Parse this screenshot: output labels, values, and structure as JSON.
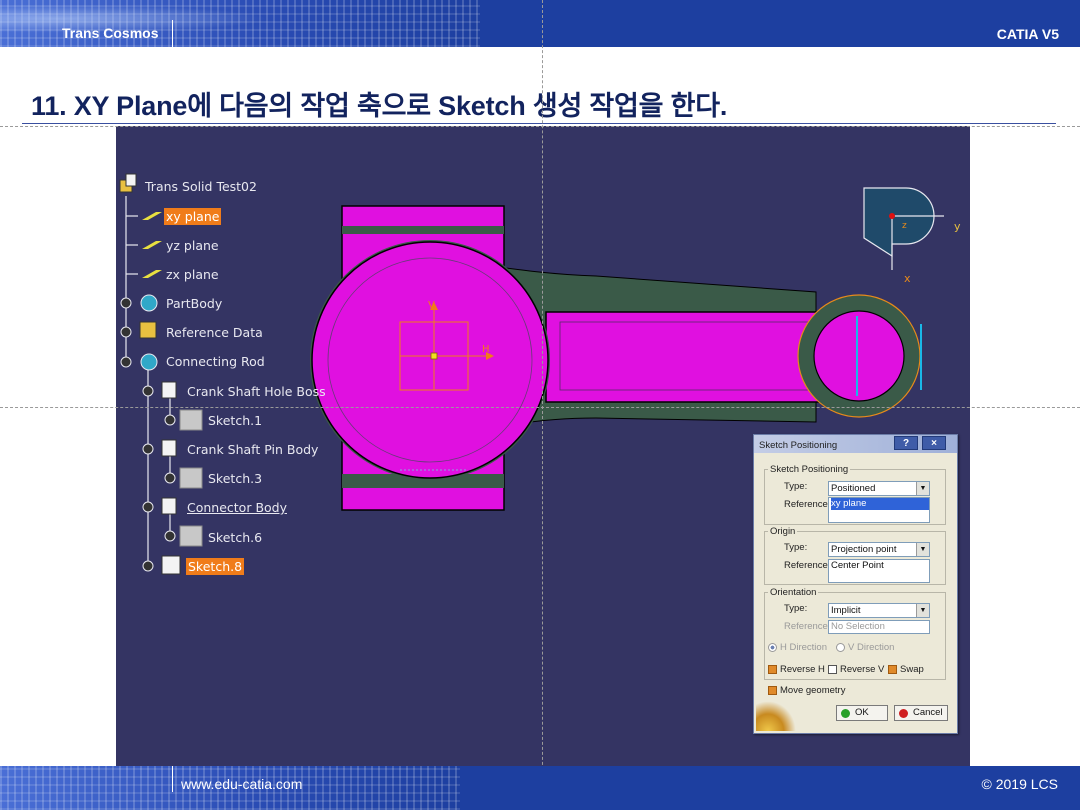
{
  "header": {
    "brand": "Trans Cosmos",
    "product": "CATIA V5"
  },
  "slide": {
    "title": "11. XY Plane에 다음의 작업 축으로 Sketch 생성 작업을 한다."
  },
  "spec_tree": {
    "root": "Trans Solid Test02",
    "items": [
      {
        "label": "xy plane",
        "state": "selected"
      },
      {
        "label": "yz plane"
      },
      {
        "label": "zx plane"
      },
      {
        "label": "PartBody"
      },
      {
        "label": "Reference Data"
      },
      {
        "label": "Connecting Rod"
      },
      {
        "label": "Crank Shaft Hole Boss"
      },
      {
        "label": "Sketch.1"
      },
      {
        "label": "Crank Shaft Pin Body"
      },
      {
        "label": "Sketch.3"
      },
      {
        "label": "Connector Body"
      },
      {
        "label": "Sketch.6"
      },
      {
        "label": "Sketch.8",
        "state": "selected"
      }
    ]
  },
  "viewport": {
    "sketch_axis_v": "V",
    "sketch_axis_h": "H",
    "compass": {
      "y_label": "y",
      "x_label": "x",
      "z_label": "z"
    },
    "colors": {
      "background": "#343463",
      "part": "#e010e0",
      "shell": "#3a5a48",
      "selection": "#f07c1a"
    }
  },
  "dialog": {
    "title": "Sketch Positioning",
    "help_button": "?",
    "close_button": "×",
    "positioning": {
      "group_label": "Sketch Positioning",
      "type_label": "Type:",
      "type_value": "Positioned",
      "reference_label": "Reference:",
      "reference_value": "xy plane"
    },
    "origin": {
      "group_label": "Origin",
      "type_label": "Type:",
      "type_value": "Projection point",
      "reference_label": "Reference:",
      "reference_value": "Center Point"
    },
    "orientation": {
      "group_label": "Orientation",
      "type_label": "Type:",
      "type_value": "Implicit",
      "reference_label": "Reference:",
      "reference_value": "No Selection",
      "h_direction": "H Direction",
      "v_direction": "V Direction",
      "reverse_h": "Reverse H",
      "reverse_v": "Reverse V",
      "swap": "Swap"
    },
    "move_geometry": "Move geometry",
    "ok": "OK",
    "cancel": "Cancel"
  },
  "footer": {
    "url": "www.edu-catia.com",
    "copyright": "© 2019 LCS"
  }
}
